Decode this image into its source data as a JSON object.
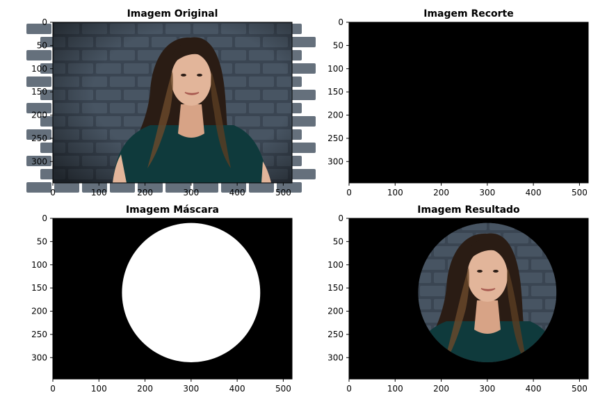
{
  "chart_data": [
    {
      "type": "image",
      "title": "Imagem Original",
      "content": "photo",
      "xlim": [
        0,
        519
      ],
      "ylim": [
        346,
        0
      ],
      "xticks": [
        0,
        100,
        200,
        300,
        400,
        500
      ],
      "yticks": [
        0,
        50,
        100,
        150,
        200,
        250,
        300
      ],
      "grid": false
    },
    {
      "type": "image",
      "title": "Imagem Recorte",
      "content": "black",
      "xlim": [
        0,
        519
      ],
      "ylim": [
        346,
        0
      ],
      "xticks": [
        0,
        100,
        200,
        300,
        400,
        500
      ],
      "yticks": [
        0,
        50,
        100,
        150,
        200,
        250,
        300
      ],
      "grid": false
    },
    {
      "type": "image",
      "title": "Imagem Máscara",
      "content": "mask",
      "xlim": [
        0,
        519
      ],
      "ylim": [
        346,
        0
      ],
      "xticks": [
        0,
        100,
        200,
        300,
        400,
        500
      ],
      "yticks": [
        0,
        50,
        100,
        150,
        200,
        250,
        300
      ],
      "grid": false
    },
    {
      "type": "image",
      "title": "Imagem Resultado",
      "content": "masked-photo",
      "xlim": [
        0,
        519
      ],
      "ylim": [
        346,
        0
      ],
      "xticks": [
        0,
        100,
        200,
        300,
        400,
        500
      ],
      "yticks": [
        0,
        50,
        100,
        150,
        200,
        250,
        300
      ],
      "grid": false
    }
  ],
  "mask_circle": {
    "cx": 300,
    "cy": 160,
    "r": 150
  },
  "colors": {
    "background": "#000000",
    "mask": "#ffffff",
    "wall": "#3a4552",
    "brick": "#4b5866",
    "hair": "#2a1c14",
    "skin": "#e2b59a",
    "shirt": "#0f3a3c"
  }
}
